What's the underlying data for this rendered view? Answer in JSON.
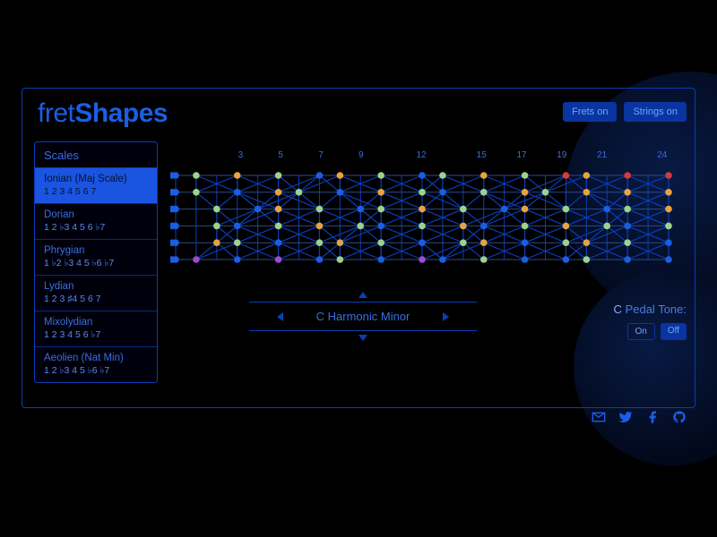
{
  "app": {
    "title_light": "fret",
    "title_bold": "Shapes"
  },
  "top_buttons": {
    "frets": "Frets on",
    "strings": "Strings on"
  },
  "scales": {
    "header": "Scales",
    "items": [
      {
        "name": "Ionian (Maj Scale)",
        "intervals": "1 2 3 4 5 6 7",
        "active": true
      },
      {
        "name": "Dorian",
        "intervals": "1 2 ♭3 4 5 6 ♭7",
        "active": false
      },
      {
        "name": "Phrygian",
        "intervals": "1 ♭2 ♭3 4 5 ♭6 ♭7",
        "active": false
      },
      {
        "name": "Lydian",
        "intervals": "1 2 3 ♯4 5 6 7",
        "active": false
      },
      {
        "name": "Mixolydian",
        "intervals": "1 2 3 4 5 6 ♭7",
        "active": false
      },
      {
        "name": "Aeolien (Nat Min)",
        "intervals": "1 2 ♭3 4 5 ♭6 ♭7",
        "active": false
      }
    ]
  },
  "fret_markers": [
    3,
    5,
    7,
    9,
    12,
    15,
    17,
    19,
    21,
    24
  ],
  "selector": {
    "current": "C Harmonic Minor"
  },
  "pedal": {
    "note": "C",
    "label": "Pedal Tone:",
    "on": "On",
    "off": "Off",
    "active": "off"
  },
  "colors": {
    "blue": "#1a5ee6",
    "green": "#9ed28a",
    "orange": "#e8a43a",
    "red": "#d83a3a",
    "purple": "#a04ad0"
  },
  "fretboard": {
    "strings": 6,
    "frets": 24,
    "notes": [
      {
        "s": 0,
        "f": 0,
        "c": "blue"
      },
      {
        "s": 0,
        "f": 1,
        "c": "green"
      },
      {
        "s": 0,
        "f": 3,
        "c": "orange"
      },
      {
        "s": 0,
        "f": 5,
        "c": "green"
      },
      {
        "s": 0,
        "f": 7,
        "c": "blue"
      },
      {
        "s": 0,
        "f": 8,
        "c": "orange"
      },
      {
        "s": 0,
        "f": 10,
        "c": "green"
      },
      {
        "s": 0,
        "f": 12,
        "c": "blue"
      },
      {
        "s": 0,
        "f": 13,
        "c": "green"
      },
      {
        "s": 0,
        "f": 15,
        "c": "orange"
      },
      {
        "s": 0,
        "f": 17,
        "c": "green"
      },
      {
        "s": 0,
        "f": 19,
        "c": "red"
      },
      {
        "s": 0,
        "f": 20,
        "c": "orange"
      },
      {
        "s": 0,
        "f": 22,
        "c": "red"
      },
      {
        "s": 0,
        "f": 24,
        "c": "red"
      },
      {
        "s": 1,
        "f": 0,
        "c": "blue"
      },
      {
        "s": 1,
        "f": 1,
        "c": "green"
      },
      {
        "s": 1,
        "f": 3,
        "c": "blue"
      },
      {
        "s": 1,
        "f": 5,
        "c": "orange"
      },
      {
        "s": 1,
        "f": 6,
        "c": "green"
      },
      {
        "s": 1,
        "f": 8,
        "c": "blue"
      },
      {
        "s": 1,
        "f": 10,
        "c": "orange"
      },
      {
        "s": 1,
        "f": 12,
        "c": "green"
      },
      {
        "s": 1,
        "f": 13,
        "c": "blue"
      },
      {
        "s": 1,
        "f": 15,
        "c": "green"
      },
      {
        "s": 1,
        "f": 17,
        "c": "orange"
      },
      {
        "s": 1,
        "f": 18,
        "c": "green"
      },
      {
        "s": 1,
        "f": 20,
        "c": "orange"
      },
      {
        "s": 1,
        "f": 22,
        "c": "orange"
      },
      {
        "s": 1,
        "f": 24,
        "c": "orange"
      },
      {
        "s": 2,
        "f": 0,
        "c": "blue"
      },
      {
        "s": 2,
        "f": 2,
        "c": "green"
      },
      {
        "s": 2,
        "f": 4,
        "c": "blue"
      },
      {
        "s": 2,
        "f": 5,
        "c": "orange"
      },
      {
        "s": 2,
        "f": 7,
        "c": "green"
      },
      {
        "s": 2,
        "f": 9,
        "c": "blue"
      },
      {
        "s": 2,
        "f": 10,
        "c": "green"
      },
      {
        "s": 2,
        "f": 12,
        "c": "orange"
      },
      {
        "s": 2,
        "f": 14,
        "c": "green"
      },
      {
        "s": 2,
        "f": 16,
        "c": "blue"
      },
      {
        "s": 2,
        "f": 17,
        "c": "orange"
      },
      {
        "s": 2,
        "f": 19,
        "c": "green"
      },
      {
        "s": 2,
        "f": 21,
        "c": "blue"
      },
      {
        "s": 2,
        "f": 22,
        "c": "green"
      },
      {
        "s": 2,
        "f": 24,
        "c": "orange"
      },
      {
        "s": 3,
        "f": 0,
        "c": "blue"
      },
      {
        "s": 3,
        "f": 2,
        "c": "green"
      },
      {
        "s": 3,
        "f": 3,
        "c": "blue"
      },
      {
        "s": 3,
        "f": 5,
        "c": "green"
      },
      {
        "s": 3,
        "f": 7,
        "c": "orange"
      },
      {
        "s": 3,
        "f": 9,
        "c": "green"
      },
      {
        "s": 3,
        "f": 10,
        "c": "blue"
      },
      {
        "s": 3,
        "f": 12,
        "c": "green"
      },
      {
        "s": 3,
        "f": 14,
        "c": "orange"
      },
      {
        "s": 3,
        "f": 15,
        "c": "blue"
      },
      {
        "s": 3,
        "f": 17,
        "c": "green"
      },
      {
        "s": 3,
        "f": 19,
        "c": "orange"
      },
      {
        "s": 3,
        "f": 21,
        "c": "green"
      },
      {
        "s": 3,
        "f": 22,
        "c": "blue"
      },
      {
        "s": 3,
        "f": 24,
        "c": "green"
      },
      {
        "s": 4,
        "f": 0,
        "c": "blue"
      },
      {
        "s": 4,
        "f": 2,
        "c": "orange"
      },
      {
        "s": 4,
        "f": 3,
        "c": "green"
      },
      {
        "s": 4,
        "f": 5,
        "c": "blue"
      },
      {
        "s": 4,
        "f": 7,
        "c": "green"
      },
      {
        "s": 4,
        "f": 8,
        "c": "orange"
      },
      {
        "s": 4,
        "f": 10,
        "c": "green"
      },
      {
        "s": 4,
        "f": 12,
        "c": "blue"
      },
      {
        "s": 4,
        "f": 14,
        "c": "green"
      },
      {
        "s": 4,
        "f": 15,
        "c": "orange"
      },
      {
        "s": 4,
        "f": 17,
        "c": "blue"
      },
      {
        "s": 4,
        "f": 19,
        "c": "green"
      },
      {
        "s": 4,
        "f": 20,
        "c": "orange"
      },
      {
        "s": 4,
        "f": 22,
        "c": "green"
      },
      {
        "s": 4,
        "f": 24,
        "c": "blue"
      },
      {
        "s": 5,
        "f": 0,
        "c": "blue"
      },
      {
        "s": 5,
        "f": 1,
        "c": "purple"
      },
      {
        "s": 5,
        "f": 3,
        "c": "blue"
      },
      {
        "s": 5,
        "f": 5,
        "c": "purple"
      },
      {
        "s": 5,
        "f": 7,
        "c": "blue"
      },
      {
        "s": 5,
        "f": 8,
        "c": "green"
      },
      {
        "s": 5,
        "f": 10,
        "c": "blue"
      },
      {
        "s": 5,
        "f": 12,
        "c": "purple"
      },
      {
        "s": 5,
        "f": 13,
        "c": "blue"
      },
      {
        "s": 5,
        "f": 15,
        "c": "green"
      },
      {
        "s": 5,
        "f": 17,
        "c": "blue"
      },
      {
        "s": 5,
        "f": 19,
        "c": "blue"
      },
      {
        "s": 5,
        "f": 20,
        "c": "green"
      },
      {
        "s": 5,
        "f": 22,
        "c": "blue"
      },
      {
        "s": 5,
        "f": 24,
        "c": "blue"
      }
    ]
  }
}
